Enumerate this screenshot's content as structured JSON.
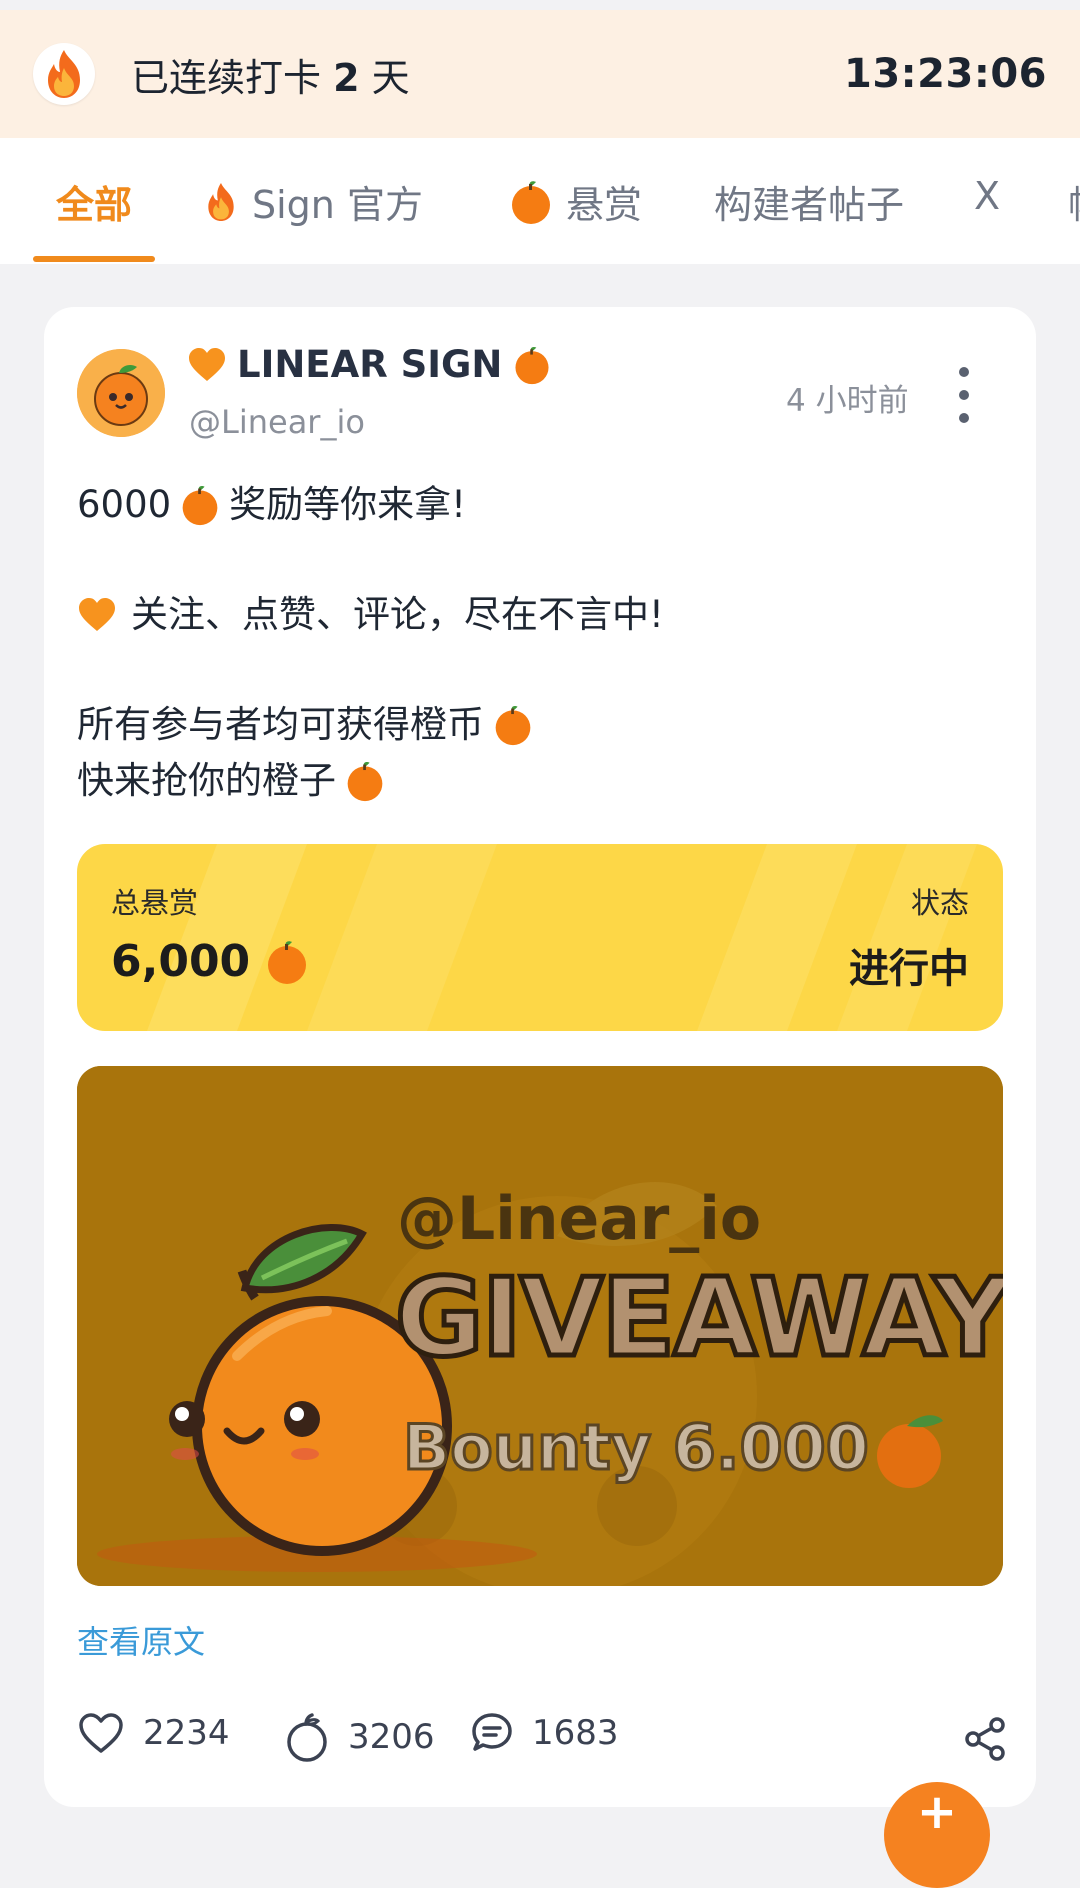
{
  "streak": {
    "prefix": "已连续打卡 ",
    "days": "2",
    "suffix": " 天",
    "clock": "13:23:06"
  },
  "tabs": [
    {
      "label": "全部",
      "icon": ""
    },
    {
      "label": "Sign 官方",
      "icon": "fire-icon"
    },
    {
      "label": "悬赏",
      "icon": "orange-icon"
    },
    {
      "label": "构建者帖子",
      "icon": ""
    },
    {
      "label": "X",
      "icon": ""
    },
    {
      "label": "帖",
      "icon": ""
    }
  ],
  "post": {
    "author_name": "LINEAR SIGN",
    "author_handle": "@Linear_io",
    "time_ago": "4 小时前",
    "lines": [
      "6000",
      "奖励等你来拿!",
      "关注、点赞、评论，尽在不言中!",
      "所有参与者均可获得橙币",
      "快来抢你的橙子"
    ],
    "bounty": {
      "label": "总悬赏",
      "value": "6,000",
      "status_label": "状态",
      "status_value": "进行中"
    },
    "image": {
      "handle": "@Linear_io",
      "headline": "GIVEAWAY",
      "subline": "Bounty 6.000"
    },
    "view_original": "查看原文",
    "likes": "2234",
    "oranges": "3206",
    "comments": "1683"
  },
  "colors": {
    "accent": "#f08a1c",
    "streak_bg": "#fdf0e3",
    "bounty_bg": "#fdd747",
    "link": "#3a9ad8"
  }
}
